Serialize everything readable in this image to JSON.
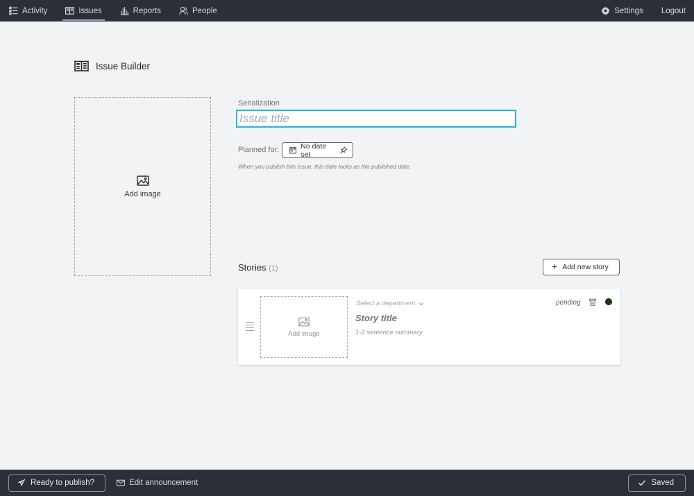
{
  "nav": {
    "items": [
      {
        "label": "Activity",
        "icon": "list-icon"
      },
      {
        "label": "Issues",
        "icon": "issues-icon",
        "active": true
      },
      {
        "label": "Reports",
        "icon": "bar-chart-icon"
      },
      {
        "label": "People",
        "icon": "people-icon"
      }
    ],
    "settings_label": "Settings",
    "logout_label": "Logout"
  },
  "page": {
    "title": "Issue Builder"
  },
  "cover": {
    "add_image_label": "Add image"
  },
  "form": {
    "serialization_label": "Serialization",
    "title_placeholder": "Issue title",
    "title_value": "",
    "planned_label": "Planned for:",
    "date_button_label": "No date set",
    "hint": "When you publish this issue, this date locks as the published date."
  },
  "stories": {
    "heading": "Stories",
    "count": "(1)",
    "add_button_label": "Add new story",
    "items": [
      {
        "add_image_label": "Add image",
        "department_placeholder": "Select a department",
        "title_placeholder": "Story title",
        "summary_placeholder": "1-2 sentence summary",
        "status": "pending",
        "status_color": "#123b12"
      }
    ]
  },
  "footer": {
    "publish_label": "Ready to publish?",
    "announcement_label": "Edit announcement",
    "saved_label": "Saved"
  },
  "colors": {
    "nav_bg": "#2b3038",
    "page_bg": "#f2f3f5",
    "focus_accent": "#2fb2d6"
  }
}
